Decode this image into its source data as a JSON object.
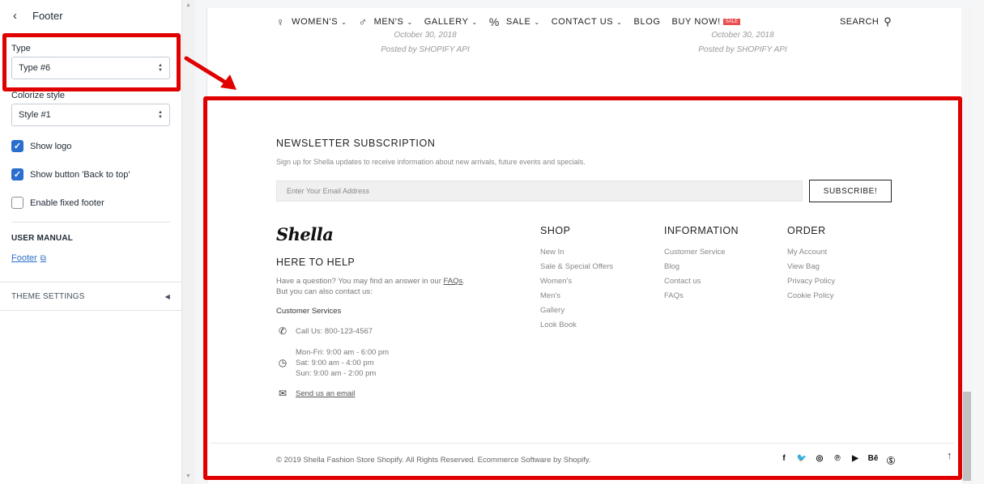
{
  "sidebar": {
    "title": "Footer",
    "type_label": "Type",
    "type_value": "Type #6",
    "colorize_label": "Colorize style",
    "colorize_value": "Style #1",
    "checkboxes": [
      {
        "label": "Show logo",
        "checked": true
      },
      {
        "label": "Show button 'Back to top'",
        "checked": true
      },
      {
        "label": "Enable fixed footer",
        "checked": false
      }
    ],
    "manual_heading": "USER MANUAL",
    "manual_link": "Footer",
    "theme_settings": "THEME SETTINGS"
  },
  "nav": {
    "items": [
      {
        "label": "WOMEN'S",
        "icon": "woman-icon",
        "chevron": true
      },
      {
        "label": "MEN'S",
        "icon": "man-icon",
        "chevron": true
      },
      {
        "label": "GALLERY",
        "chevron": true
      },
      {
        "label": "SALE",
        "icon": "percent-icon",
        "chevron": true
      },
      {
        "label": "CONTACT US",
        "chevron": true
      },
      {
        "label": "BLOG",
        "chevron": false
      },
      {
        "label": "BUY NOW!",
        "badge": "SALE",
        "chevron": false
      }
    ],
    "search": "SEARCH"
  },
  "posts": [
    {
      "date": "October 30, 2018",
      "author": "Posted by SHOPIFY API"
    },
    {
      "date": "October 30, 2018",
      "author": "Posted by SHOPIFY API"
    }
  ],
  "newsletter": {
    "title": "NEWSLETTER SUBSCRIPTION",
    "subtitle": "Sign up for Shella updates to receive information about new arrivals, future events and specials.",
    "placeholder": "Enter Your Email Address",
    "button": "SUBSCRIBE!"
  },
  "brand": {
    "logo": "Shella",
    "help_title": "HERE TO HELP",
    "help_text_1": "Have a question? You may find an answer in our ",
    "help_faq": "FAQs",
    "help_text_2": ".",
    "help_text_3": "But you can also contact us:",
    "cs_title": "Customer Services",
    "phone": "Call Us: 800-123-4567",
    "hours": [
      "Mon-Fri: 9:00 am - 6:00 pm",
      "Sat: 9:00 am - 4:00 pm",
      "Sun: 9:00 am - 2:00 pm"
    ],
    "email": "Send us an email"
  },
  "columns": {
    "shop": {
      "title": "SHOP",
      "items": [
        "New In",
        "Sale & Special Offers",
        "Women's",
        "Men's",
        "Gallery",
        "Look Book"
      ]
    },
    "information": {
      "title": "INFORMATION",
      "items": [
        "Customer Service",
        "Blog",
        "Contact us",
        "FAQs"
      ]
    },
    "order": {
      "title": "ORDER",
      "items": [
        "My Account",
        "View Bag",
        "Privacy Policy",
        "Cookie Policy"
      ]
    }
  },
  "bottom": {
    "copyright": "© 2019 Shella Fashion Store Shopify. All Rights Reserved. Ecommerce Software by Shopify.",
    "socials": [
      "facebook-icon",
      "twitter-icon",
      "instagram-icon",
      "pinterest-icon",
      "youtube-icon",
      "behance-icon",
      "skype-icon"
    ]
  },
  "colors": {
    "highlight": "#e00000",
    "checkbox": "#2b6fce",
    "link": "#2c6ecb",
    "sale_badge": "#e94d4d"
  }
}
